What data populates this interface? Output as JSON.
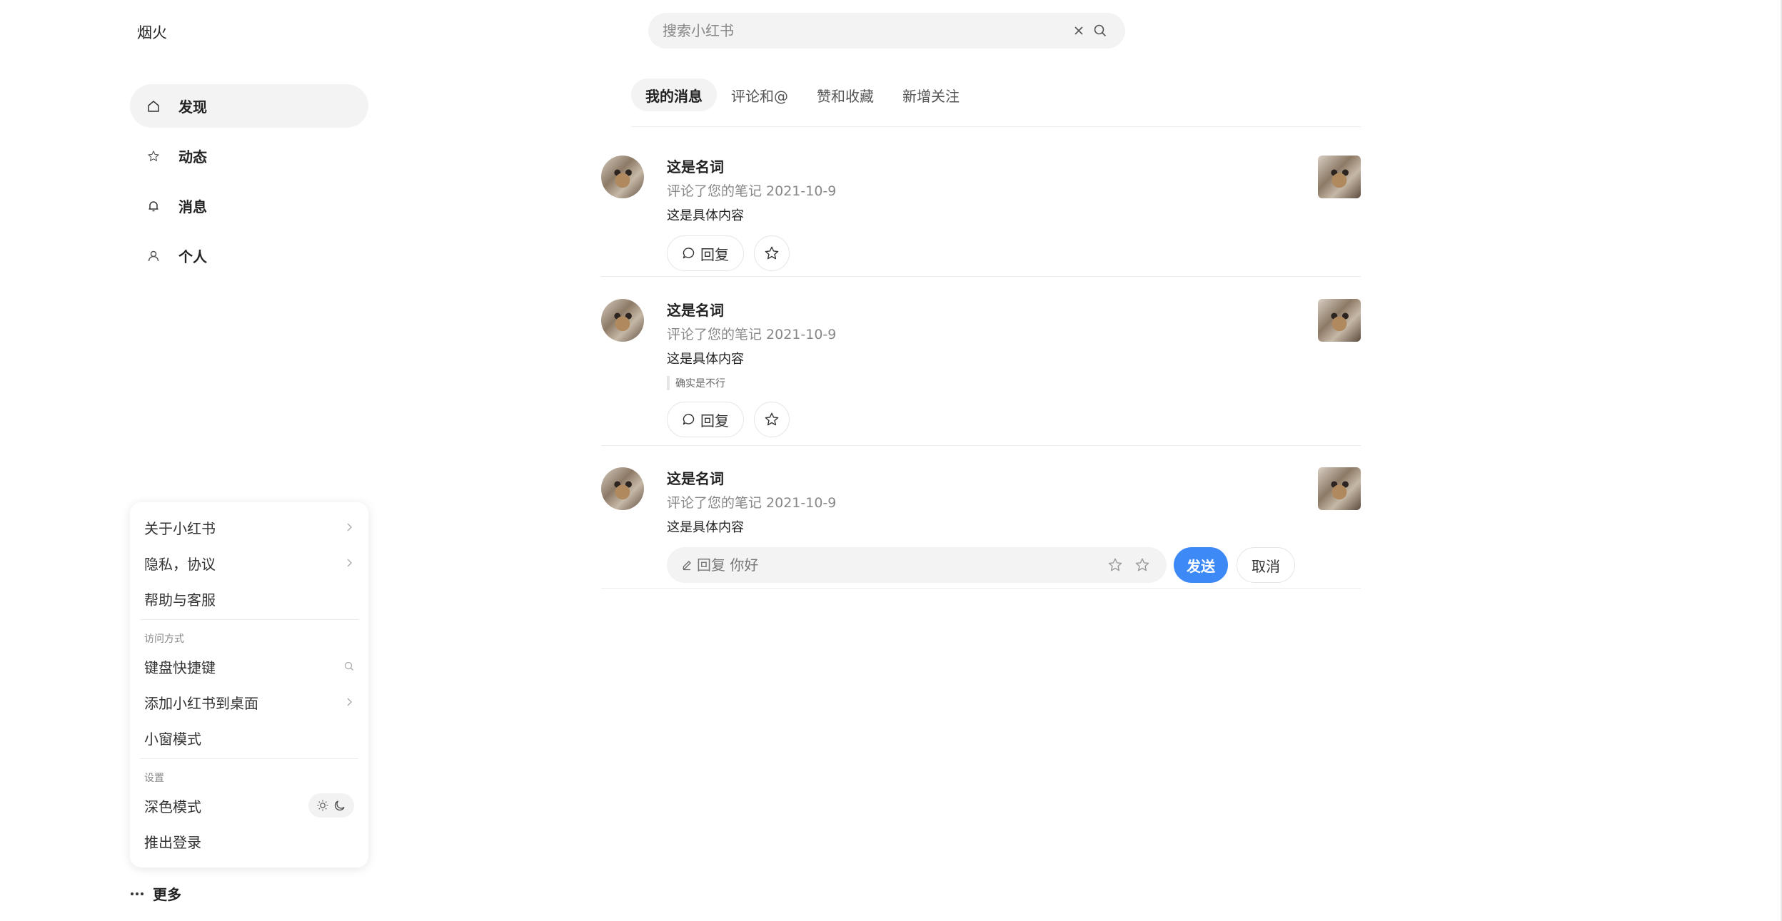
{
  "brand": {
    "logo_text": "烟火"
  },
  "search": {
    "placeholder": "搜索小红书",
    "value": ""
  },
  "sidebar": {
    "items": [
      {
        "label": "发现",
        "icon": "home-icon",
        "active": true
      },
      {
        "label": "动态",
        "icon": "star-icon",
        "active": false
      },
      {
        "label": "消息",
        "icon": "bell-icon",
        "active": false
      },
      {
        "label": "个人",
        "icon": "user-icon",
        "active": false
      }
    ],
    "more_label": "更多"
  },
  "more_menu": {
    "about": "关于小红书",
    "privacy": "隐私，协议",
    "help": "帮助与客服",
    "access_header": "访问方式",
    "shortcuts": "键盘快捷键",
    "add_desktop": "添加小红书到桌面",
    "mini_mode": "小窗模式",
    "settings_header": "设置",
    "dark_mode": "深色模式",
    "logout": "推出登录"
  },
  "tabs": [
    {
      "label": "我的消息",
      "active": true
    },
    {
      "label": "评论和@",
      "active": false
    },
    {
      "label": "赞和收藏",
      "active": false
    },
    {
      "label": "新增关注",
      "active": false
    }
  ],
  "messages": [
    {
      "name": "这是名词",
      "meta": "评论了您的笔记 2021-10-9",
      "content": "这是具体内容",
      "quote": "",
      "reply_label": "回复"
    },
    {
      "name": "这是名词",
      "meta": "评论了您的笔记 2021-10-9",
      "content": "这是具体内容",
      "quote": "确实是不行",
      "reply_label": "回复"
    },
    {
      "name": "这是名词",
      "meta": "评论了您的笔记 2021-10-9",
      "content": "这是具体内容",
      "quote": "",
      "reply_label": "回复"
    }
  ],
  "reply_box": {
    "placeholder": "回复 你好",
    "send_label": "发送",
    "cancel_label": "取消"
  },
  "colors": {
    "accent": "#3d8af7",
    "active_bg": "#f3f3f3",
    "divider": "#ececec"
  }
}
